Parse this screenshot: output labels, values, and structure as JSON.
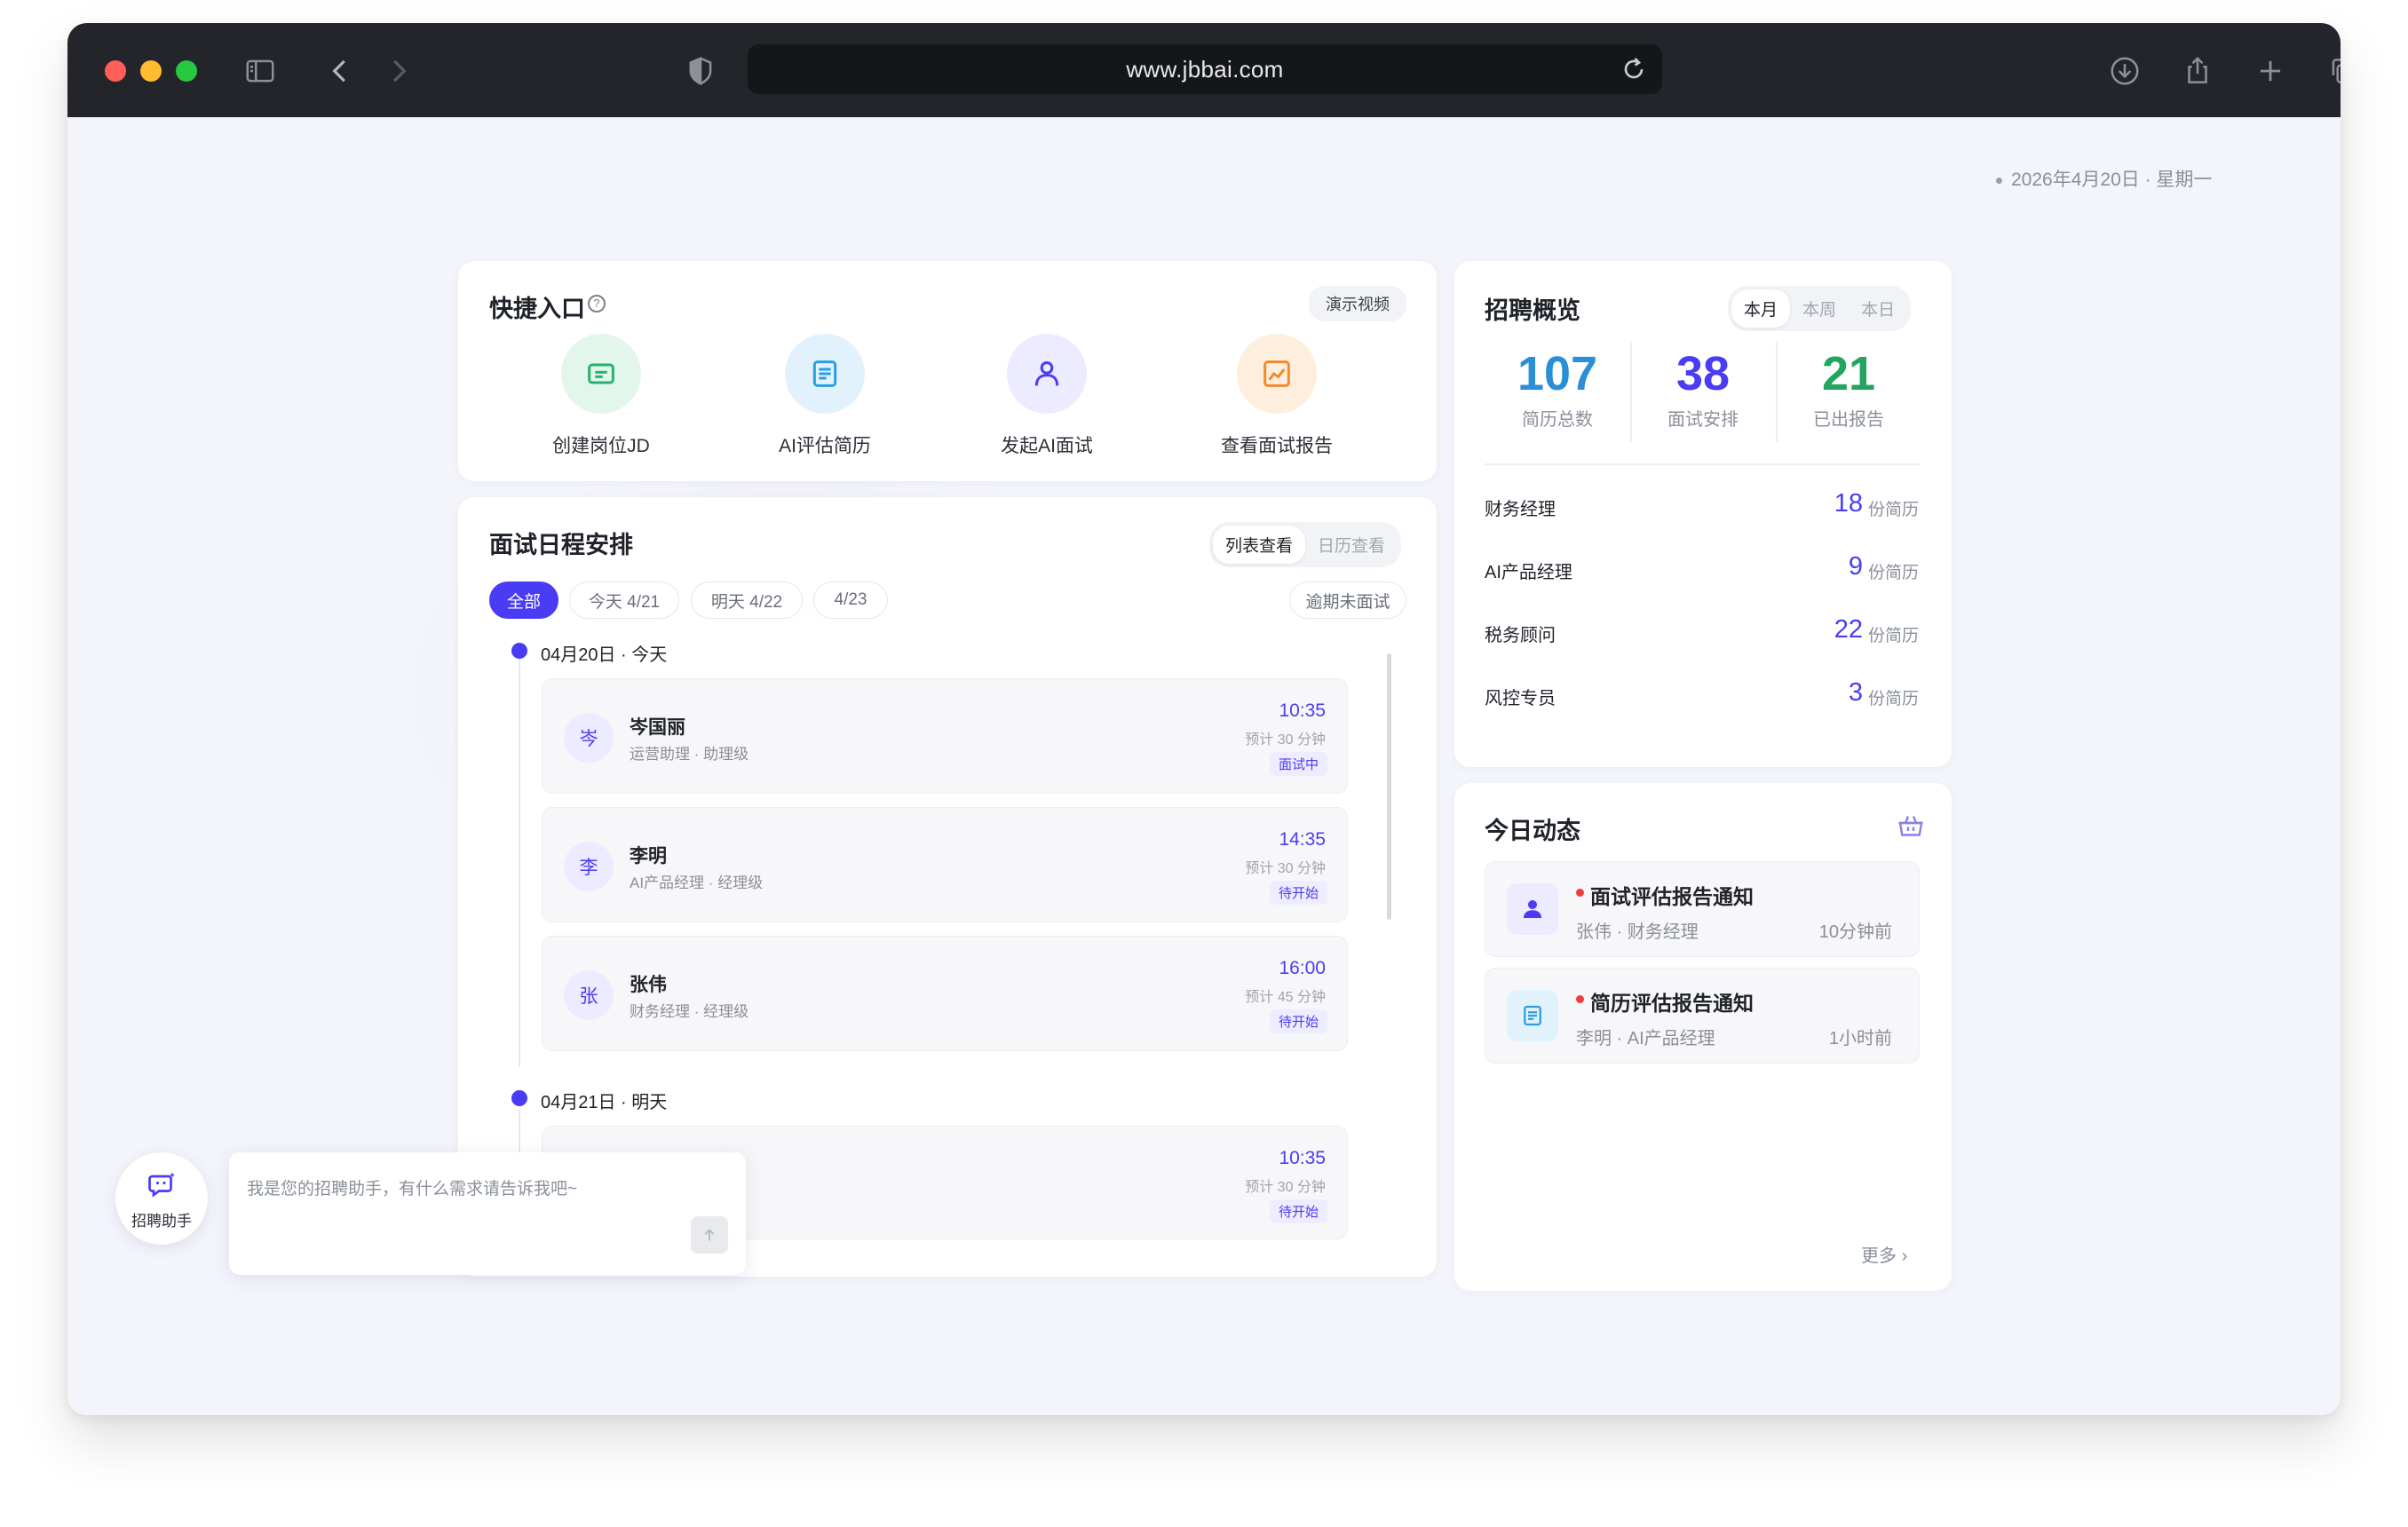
{
  "browser": {
    "url": "www.jbbai.com"
  },
  "date_text": "2026年4月20日 · 星期一",
  "quick_entry": {
    "title": "快捷入口",
    "demo_button": "演示视频",
    "items": [
      {
        "label": "创建岗位JD",
        "icon": "jd-card-icon",
        "color": "#22b46e"
      },
      {
        "label": "AI评估简历",
        "icon": "document-icon",
        "color": "#2a9fe0"
      },
      {
        "label": "发起AI面试",
        "icon": "user-icon",
        "color": "#4a3cf4"
      },
      {
        "label": "查看面试报告",
        "icon": "chart-icon",
        "color": "#f08a2a"
      }
    ]
  },
  "schedule": {
    "title": "面试日程安排",
    "view_list": "列表查看",
    "view_calendar": "日历查看",
    "filters": [
      "全部",
      "今天 4/21",
      "明天 4/22",
      "4/23"
    ],
    "overdue": "逾期未面试",
    "days": [
      {
        "label": "04月20日 · 今天",
        "interviews": [
          {
            "avatar": "岑",
            "name": "岑国丽",
            "role": "运营助理 · 助理级",
            "time": "10:35",
            "duration": "预计 30 分钟",
            "status": "面试中"
          },
          {
            "avatar": "李",
            "name": "李明",
            "role": "AI产品经理 · 经理级",
            "time": "14:35",
            "duration": "预计 30 分钟",
            "status": "待开始"
          },
          {
            "avatar": "张",
            "name": "张伟",
            "role": "财务经理 · 经理级",
            "time": "16:00",
            "duration": "预计 45 分钟",
            "status": "待开始"
          }
        ]
      },
      {
        "label": "04月21日 · 明天",
        "interviews": [
          {
            "time": "10:35",
            "duration": "预计 30 分钟",
            "status": "待开始"
          }
        ]
      }
    ]
  },
  "overview": {
    "title": "招聘概览",
    "tabs": [
      "本月",
      "本周",
      "本日"
    ],
    "stats": [
      {
        "value": "107",
        "label": "简历总数",
        "color": "#2a8fd6"
      },
      {
        "value": "38",
        "label": "面试安排",
        "color": "#4a3cf4"
      },
      {
        "value": "21",
        "label": "已出报告",
        "color": "#22a55e"
      }
    ],
    "unit": "份简历",
    "positions": [
      {
        "name": "财务经理",
        "count": "18"
      },
      {
        "name": "AI产品经理",
        "count": "9"
      },
      {
        "name": "税务顾问",
        "count": "22"
      },
      {
        "name": "风控专员",
        "count": "3"
      }
    ]
  },
  "activity": {
    "title": "今日动态",
    "items": [
      {
        "title": "面试评估报告通知",
        "sub": "张伟 · 财务经理",
        "time": "10分钟前",
        "icon": "user-icon"
      },
      {
        "title": "简历评估报告通知",
        "sub": "李明 · AI产品经理",
        "time": "1小时前",
        "icon": "document-icon"
      }
    ],
    "more": "更多"
  },
  "assistant": {
    "label": "招聘助手",
    "placeholder": "我是您的招聘助手，有什么需求请告诉我吧~"
  }
}
